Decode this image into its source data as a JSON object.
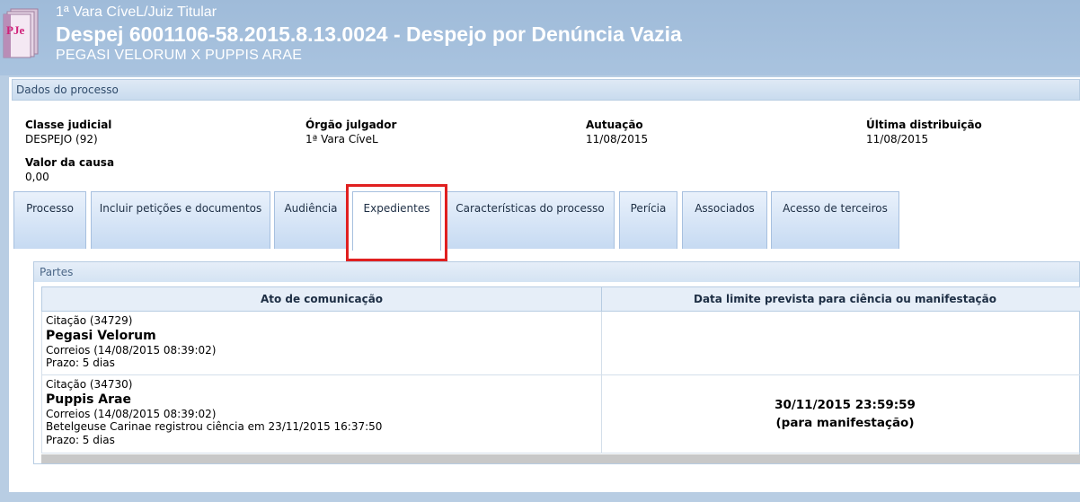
{
  "header": {
    "orgao": "1ª Vara CíveL/Juiz Titular",
    "title": "Despej 6001106-58.2015.8.13.0024 - Despejo por Denúncia Vazia",
    "parties": "PEGASI VELORUM X PUPPIS ARAE",
    "logo_icon": "pje-logo-icon",
    "logo_text": "PJe"
  },
  "dados": {
    "panel_title": "Dados do processo",
    "fields": [
      {
        "label": "Classe judicial",
        "value": "DESPEJO (92)"
      },
      {
        "label": "Órgão julgador",
        "value": "1ª Vara CíveL"
      },
      {
        "label": "Autuação",
        "value": "11/08/2015"
      },
      {
        "label": "Última distribuição",
        "value": "11/08/2015"
      },
      {
        "label": "Valor da causa",
        "value": "0,00"
      }
    ]
  },
  "tabs": [
    {
      "label": "Processo"
    },
    {
      "label": "Incluir petições e documentos"
    },
    {
      "label": "Audiência"
    },
    {
      "label": "Expedientes",
      "active": true
    },
    {
      "label": "Características do processo"
    },
    {
      "label": "Perícia"
    },
    {
      "label": "Associados"
    },
    {
      "label": "Acesso de terceiros"
    }
  ],
  "partes": {
    "panel_title": "Partes",
    "columns": [
      "Ato de comunicação",
      "Data limite prevista para ciência ou manifestação"
    ],
    "rows": [
      {
        "citacao": "Citação (34729)",
        "nome": "Pegasi Velorum",
        "meio": "Correios (14/08/2015 08:39:02)",
        "ciencia": "",
        "prazo": "Prazo: 5 dias",
        "data_limite": "",
        "data_tipo": ""
      },
      {
        "citacao": "Citação (34730)",
        "nome": "Puppis Arae",
        "meio": "Correios (14/08/2015 08:39:02)",
        "ciencia": "Betelgeuse Carinae registrou ciência em 23/11/2015 16:37:50",
        "prazo": "Prazo: 5 dias",
        "data_limite": "30/11/2015 23:59:59",
        "data_tipo": "(para manifestação)"
      }
    ]
  },
  "colors": {
    "header_bg": "#a9c3df",
    "highlight": "#e02020",
    "tab_bg": "#c6daf2"
  }
}
